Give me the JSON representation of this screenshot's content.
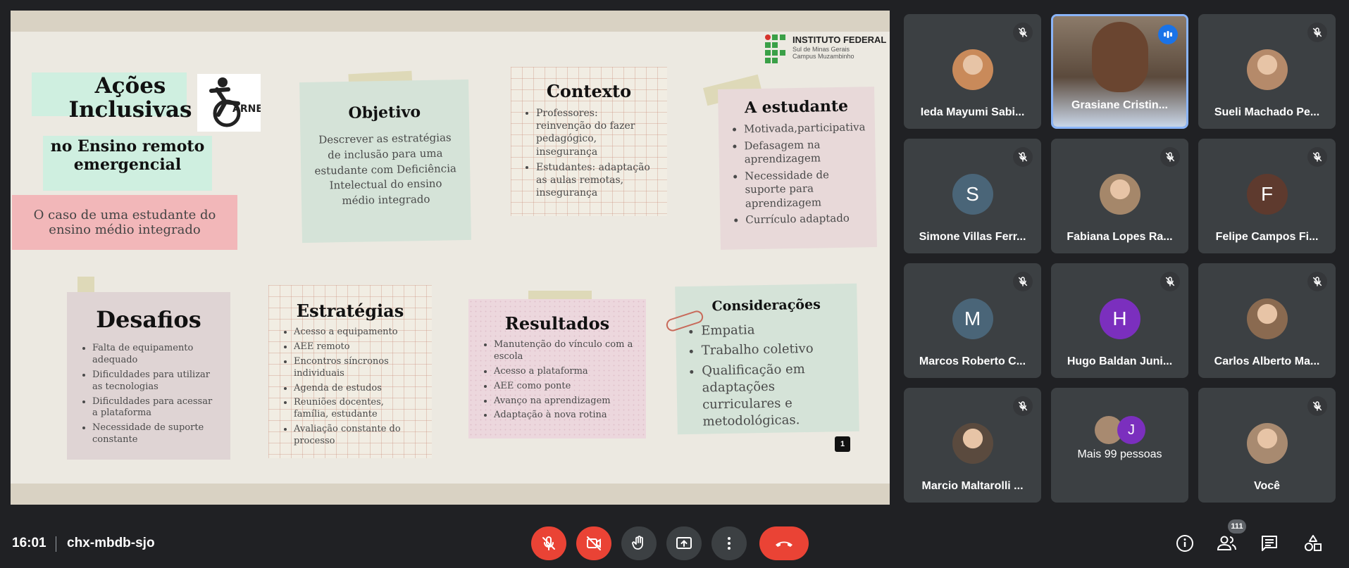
{
  "slide": {
    "title": "Ações Inclusivas",
    "logo_text": "ARNE",
    "subtitle": "no Ensino remoto emergencial",
    "case": "O caso de uma estudante do ensino médio integrado",
    "institute": {
      "name": "INSTITUTO FEDERAL",
      "line2": "Sul de Minas Gerais",
      "line3": "Campus Muzambinho"
    },
    "objetivo": {
      "title": "Objetivo",
      "text": "Descrever as estratégias de inclusão para uma estudante com Deficiência Intelectual do ensino médio integrado"
    },
    "contexto": {
      "title": "Contexto",
      "items": [
        "Professores: reinvenção do fazer pedagógico, insegurança",
        "Estudantes: adaptação as aulas remotas, insegurança"
      ]
    },
    "estudante": {
      "title": "A estudante",
      "items": [
        "Motivada,participativa",
        "Defasagem na aprendizagem",
        "Necessidade de suporte para aprendizagem",
        "Currículo adaptado"
      ]
    },
    "desafios": {
      "title": "Desafios",
      "items": [
        "Falta de equipamento adequado",
        "Dificuldades para utilizar as tecnologias",
        "Dificuldades para acessar a plataforma",
        "Necessidade de suporte constante"
      ]
    },
    "estrategias": {
      "title": "Estratégias",
      "items": [
        "Acesso a equipamento",
        "AEE remoto",
        "Encontros síncronos individuais",
        "Agenda de estudos",
        "Reuniões docentes, família, estudante",
        "Avaliação constante do processo"
      ]
    },
    "resultados": {
      "title": "Resultados",
      "items": [
        "Manutenção do vínculo com a escola",
        "Acesso a plataforma",
        "AEE como ponte",
        "Avanço na aprendizagem",
        "Adaptação à nova rotina"
      ]
    },
    "consideracoes": {
      "title": "Considerações",
      "items": [
        "Empatia",
        "Trabalho coletivo",
        "Qualificação em adaptações curriculares e metodológicas."
      ]
    },
    "page_number": "1"
  },
  "participants": [
    {
      "name": "Ieda Mayumi Sabi...",
      "muted": true,
      "avatar": "photo",
      "color": "#c98a5a"
    },
    {
      "name": "Grasiane Cristin...",
      "muted": false,
      "avatar": "video",
      "color": "#6b5a4a"
    },
    {
      "name": "Sueli Machado Pe...",
      "muted": true,
      "avatar": "photo",
      "color": "#b58a6a"
    },
    {
      "name": "Simone Villas Ferr...",
      "muted": true,
      "avatar": "letter",
      "initial": "S",
      "color": "#4a6578"
    },
    {
      "name": "Fabiana Lopes Ra...",
      "muted": true,
      "avatar": "photo",
      "color": "#a5876a"
    },
    {
      "name": "Felipe Campos Fi...",
      "muted": true,
      "avatar": "letter",
      "initial": "F",
      "color": "#5e3a2e"
    },
    {
      "name": "Marcos Roberto C...",
      "muted": true,
      "avatar": "letter",
      "initial": "M",
      "color": "#4a6578"
    },
    {
      "name": "Hugo Baldan Juni...",
      "muted": true,
      "avatar": "letter",
      "initial": "H",
      "color": "#7b2fbe"
    },
    {
      "name": "Carlos Alberto Ma...",
      "muted": true,
      "avatar": "photo",
      "color": "#8a6a50"
    },
    {
      "name": "Marcio Maltarolli ...",
      "muted": true,
      "avatar": "photo",
      "color": "#5a4a3e"
    },
    {
      "name": "Mais 99 pessoas",
      "muted": false,
      "avatar": "group",
      "initial": "J",
      "color": "#7b2fbe"
    },
    {
      "name": "Você",
      "muted": true,
      "avatar": "photo",
      "color": "#a88a70"
    }
  ],
  "bottom": {
    "time": "16:01",
    "meeting_code": "chx-mbdb-sjo",
    "people_count": "111"
  },
  "colors": {
    "background": "#202124",
    "tile": "#3c4043",
    "red": "#ea4335",
    "active_border": "#8ab4f8"
  }
}
